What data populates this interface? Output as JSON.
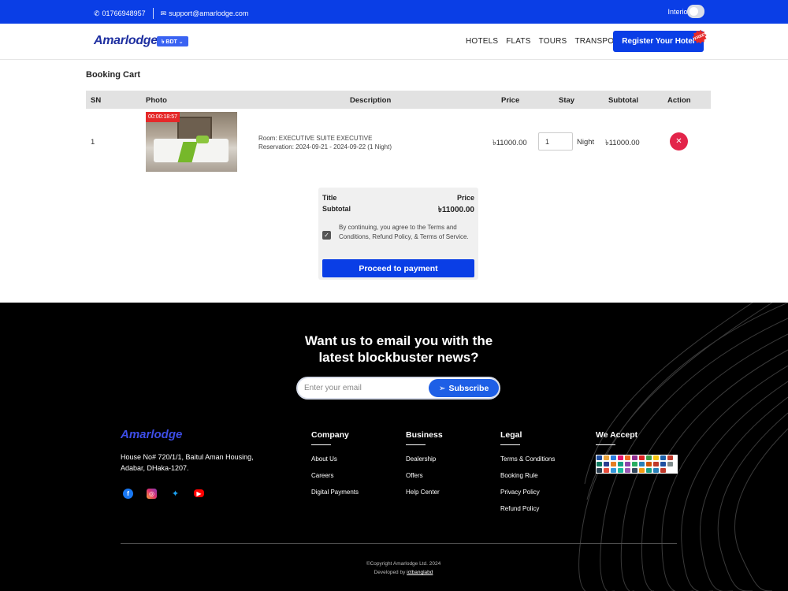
{
  "topbar": {
    "phone": "01766948957",
    "email": "support@amarlodge.com",
    "interior_label": "Interior Info"
  },
  "nav": {
    "logo": "Amarlodge",
    "currency": "৳ BDT",
    "menu": [
      "HOTELS",
      "FLATS",
      "TOURS",
      "TRANSPORTS"
    ],
    "register_label": "Register Your Hotel",
    "free_badge": "FREE"
  },
  "cart": {
    "title": "Booking Cart",
    "columns": [
      "SN",
      "Photo",
      "Description",
      "Price",
      "Stay",
      "Subtotal",
      "Action"
    ],
    "rows": [
      {
        "sn": "1",
        "timer": "00:00:18:57",
        "room": "Room: EXECUTIVE SUITE EXECUTIVE",
        "reservation": "Reservation: 2024-09-21 - 2024-09-22 (1 Night)",
        "price": "৳11000.00",
        "stay_qty": "1",
        "stay_unit": "Night",
        "subtotal": "৳11000.00"
      }
    ]
  },
  "summary": {
    "title_label": "Title",
    "price_label": "Price",
    "subtotal_label": "Subtotal",
    "subtotal_value": "৳11000.00",
    "terms": "By continuing, you agree to the Terms and Conditions, Refund Policy, & Terms of Service.",
    "proceed_label": "Proceed to payment"
  },
  "footer": {
    "newsletter_line1": "Want us to email you with the",
    "newsletter_line2": "latest blockbuster news?",
    "email_placeholder": "Enter your email",
    "subscribe_label": "Subscribe",
    "logo": "Amarlodge",
    "address_line1": "House No# 720/1/1, Baitul Aman Housing,",
    "address_line2": "Adabar, DHaka-1207.",
    "columns": [
      {
        "title": "Company",
        "links": [
          "About Us",
          "Careers",
          "Digital Payments"
        ]
      },
      {
        "title": "Business",
        "links": [
          "Dealership",
          "Offers",
          "Help Center"
        ]
      },
      {
        "title": "Legal",
        "links": [
          "Terms & Conditions",
          "Booking Rule",
          "Privacy Policy",
          "Refund Policy"
        ]
      },
      {
        "title": "We Accept",
        "links": []
      }
    ],
    "copyright": "©Copyright Amarlodge Ltd. 2024",
    "developed_prefix": "Developed by",
    "developer": "ictbanglabd"
  },
  "colors": {
    "brand": "#0a3ee6",
    "delete": "#e3244a",
    "timer": "#e52929"
  }
}
